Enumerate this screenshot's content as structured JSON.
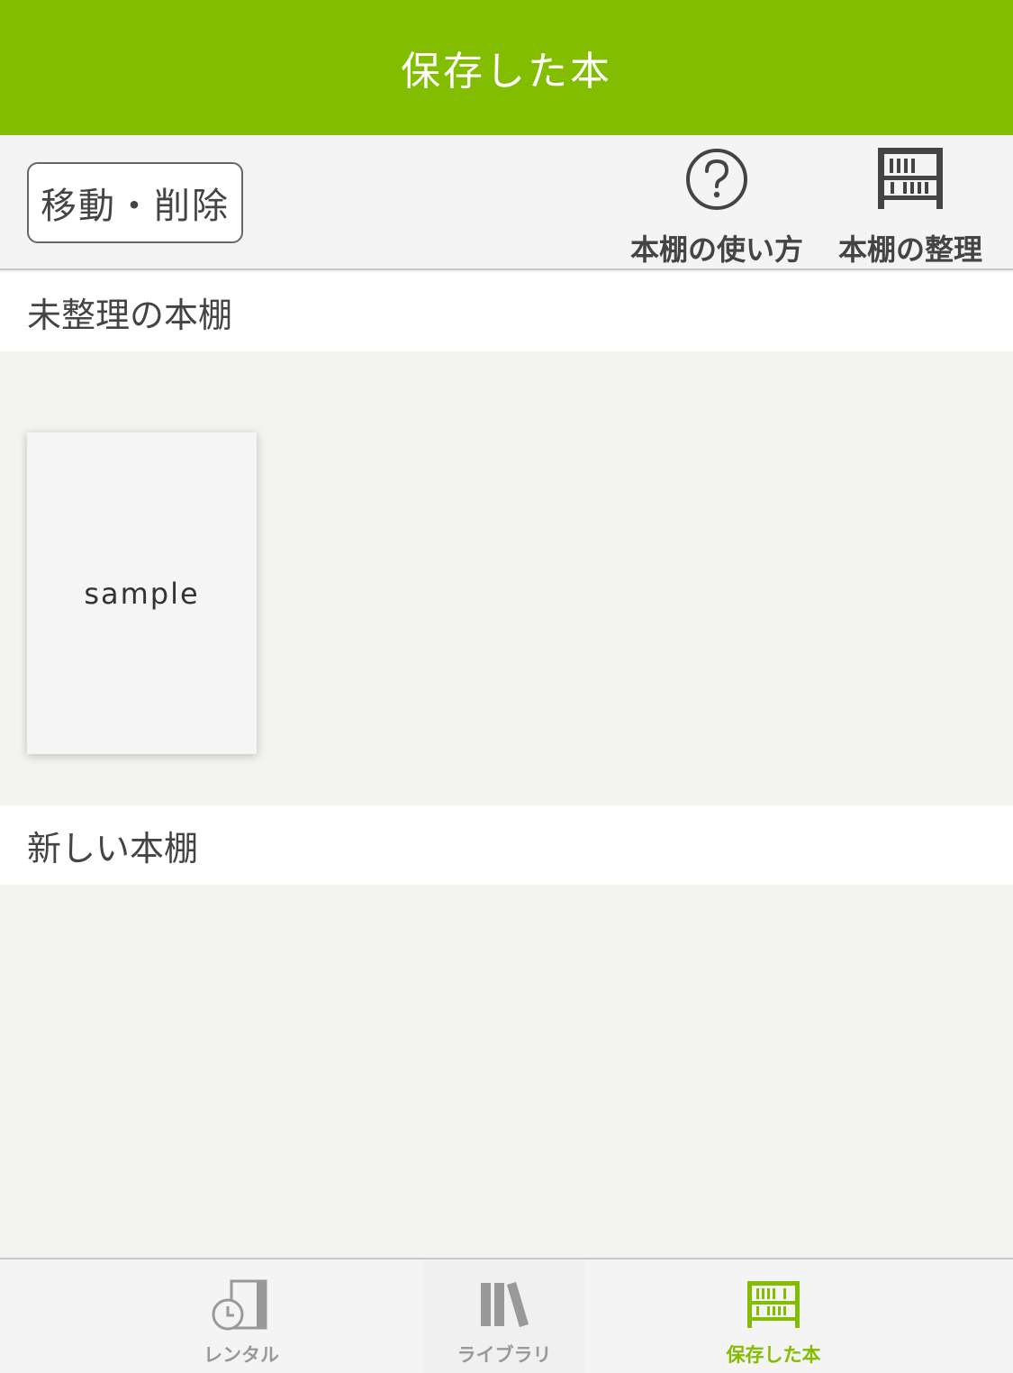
{
  "header": {
    "title": "保存した本"
  },
  "toolbar": {
    "edit_label": "移動・削除",
    "help_label": "本棚の使い方",
    "organize_label": "本棚の整理",
    "help_icon": "question-circle-icon",
    "organize_icon": "bookshelf-icon"
  },
  "sections": {
    "unsorted_title": "未整理の本棚",
    "new_title": "新しい本棚"
  },
  "books": [
    {
      "title": "sample"
    }
  ],
  "tabs": [
    {
      "label": "レンタル",
      "icon": "rental-clock-book-icon",
      "active": false
    },
    {
      "label": "ライブラリ",
      "icon": "library-books-icon",
      "active": false
    },
    {
      "label": "保存した本",
      "icon": "bookshelf-icon",
      "active": true
    }
  ],
  "colors": {
    "brand": "#82bd00",
    "inactive": "#999999"
  }
}
